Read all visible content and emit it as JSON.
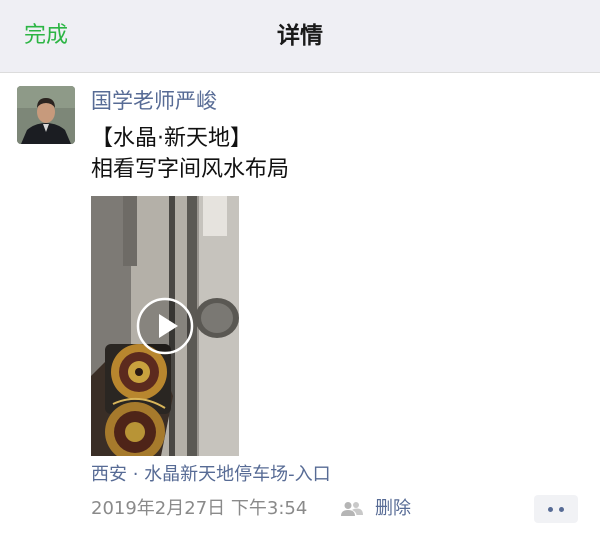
{
  "navbar": {
    "done_label": "完成",
    "title": "详情"
  },
  "post": {
    "author": "国学老师严峻",
    "text": "【水晶·新天地】\n相看写字间风水布局",
    "video": {
      "play_icon": "play-icon"
    },
    "location": "西安 · 水晶新天地停车场-入口",
    "timestamp": "2019年2月27日 下午3:54",
    "visibility_icon": "friends-icon",
    "delete_label": "删除",
    "more_icon": "more-dots-icon"
  },
  "colors": {
    "nav_background": "#efeff4",
    "done_green": "#2cb544",
    "link_blue": "#576b95",
    "meta_gray": "#8a8a8a"
  }
}
